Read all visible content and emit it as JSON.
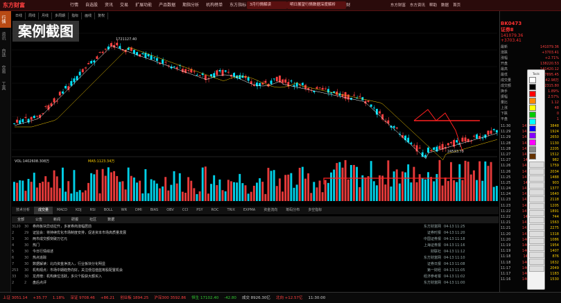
{
  "app": {
    "logo": "东方财富",
    "menu": [
      "行情",
      "自选股",
      "资讯",
      "交易",
      "扩展功能",
      "产品数据",
      "期指分析",
      "机构榜单",
      "东方指标",
      "全球焦点",
      "港美股",
      "期货",
      "外汇",
      "债券",
      "理财"
    ],
    "notices": [
      "3月行情解读",
      "明日展望行情数据深度解析"
    ],
    "right_menu": [
      "东方财富",
      "东方资讯",
      "帮助",
      "数据",
      "首页"
    ]
  },
  "overlay_title": "案例截图",
  "left_rail": [
    "行情",
    "资讯",
    "自选",
    "交易",
    "工具"
  ],
  "chart": {
    "tabs": [
      "日线",
      "周线",
      "月线",
      "多周期",
      "指标",
      "画线",
      "复权"
    ],
    "stock_title": "证券Ⅱ",
    "high_label": "1721127.40",
    "low_label": "24533.70",
    "volume_title": "VOL:1402608.308万",
    "volume_ma": "MA5:1123.34万",
    "colors": {
      "up": "#ff4040",
      "down": "#00e5ff",
      "ma5": "#ffffff",
      "ma10": "#ffd000",
      "ma20": "#ff00ff",
      "marker": "#ff2020"
    }
  },
  "bottom_tabs": [
    "技术分析",
    "成交量",
    "MACD",
    "KDJ",
    "RSI",
    "BOLL",
    "WR",
    "DMI",
    "BIAS",
    "OBV",
    "CCI",
    "PSY",
    "ROC",
    "TRIX",
    "EXPMA",
    "资金流向",
    "筹码分布",
    "多空指标"
  ],
  "news": {
    "head": [
      "全部",
      "公告",
      "新闻",
      "研报",
      "社区",
      "数据"
    ],
    "rows": [
      {
        "a": "3120",
        "b": "30",
        "text": "券商板块异动拉升，多家券商涨幅居前"
      },
      {
        "a": "2",
        "b": "29",
        "text": "证监会：将持续优化市场制度安排，促进资本市场高质量发展"
      },
      {
        "a": "3",
        "b": "30",
        "text": "两市成交额突破万亿元"
      },
      {
        "a": "4",
        "b": "30",
        "text": "热门"
      },
      {
        "a": "5",
        "b": "30",
        "text": "今日行情综述"
      },
      {
        "a": "6",
        "b": "30",
        "text": "热点追踪"
      },
      {
        "a": "7",
        "b": "30",
        "text": "数据解读：北向资金净流入，行业板块分化明显"
      },
      {
        "a": "253",
        "b": "30",
        "text": "机构观点：市场中期趋势向好，关注低估值蓝筹股配置机会"
      },
      {
        "a": "33",
        "b": "30",
        "text": "龙虎榜：机构席位活跃，多只个股获大额买入"
      },
      {
        "a": "2",
        "b": "2",
        "text": "盘后点评"
      }
    ],
    "right_rows": [
      {
        "src": "东方财富网",
        "t": "04-13 11:25"
      },
      {
        "src": "证券时报",
        "t": "04-13 11:20"
      },
      {
        "src": "中国证券报",
        "t": "04-13 11:18"
      },
      {
        "src": "上海证券报",
        "t": "04-13 11:16"
      },
      {
        "src": "财联社",
        "t": "04-13 11:12"
      },
      {
        "src": "东方财富网",
        "t": "04-13 11:10"
      },
      {
        "src": "证券日报",
        "t": "04-13 11:08"
      },
      {
        "src": "第一财经",
        "t": "04-13 11:05"
      },
      {
        "src": "经济参考报",
        "t": "04-13 11:02"
      },
      {
        "src": "东方财富网",
        "t": "04-13 11:00"
      }
    ]
  },
  "right_panel": {
    "code": "BK0473",
    "name": "证券Ⅱ",
    "price": "141079.36",
    "change": "+3703.41",
    "pct": "+2.71%",
    "quotes": [
      {
        "k": "最新",
        "v": "141079.36"
      },
      {
        "k": "涨跌",
        "v": "+3703.41"
      },
      {
        "k": "涨幅",
        "v": "+2.71%"
      },
      {
        "k": "开盘",
        "v": "138220.53"
      },
      {
        "k": "最高",
        "v": "141420.12"
      },
      {
        "k": "最低",
        "v": "137895.45"
      },
      {
        "k": "成交量",
        "v": "442.98万"
      },
      {
        "k": "成交额",
        "v": "72315.80"
      },
      {
        "k": "换手",
        "v": "1.89%"
      },
      {
        "k": "振幅",
        "v": "2.57%"
      },
      {
        "k": "量比",
        "v": "1.12"
      },
      {
        "k": "上涨",
        "v": "48"
      },
      {
        "k": "下跌",
        "v": "0"
      },
      {
        "k": "平盘",
        "v": "1"
      }
    ],
    "ticks": [
      {
        "tm": "11:30",
        "pr": "141079.3",
        "vl": "3848"
      },
      {
        "tm": "11:29",
        "pr": "141075.2",
        "vl": "1924"
      },
      {
        "tm": "11:29",
        "pr": "141070.8",
        "vl": "2650"
      },
      {
        "tm": "11:28",
        "pr": "141066.1",
        "vl": "1130"
      },
      {
        "tm": "11:28",
        "pr": "141061.7",
        "vl": "2205"
      },
      {
        "tm": "11:27",
        "pr": "141058.3",
        "vl": "1512"
      },
      {
        "tm": "11:27",
        "pr": "141052.0",
        "vl": "982"
      },
      {
        "tm": "11:26",
        "pr": "141048.6",
        "vl": "1759"
      },
      {
        "tm": "11:26",
        "pr": "141043.2",
        "vl": "2034"
      },
      {
        "tm": "11:25",
        "pr": "141040.9",
        "vl": "1488"
      },
      {
        "tm": "11:25",
        "pr": "141036.4",
        "vl": "903"
      },
      {
        "tm": "11:24",
        "pr": "141031.1",
        "vl": "1377"
      },
      {
        "tm": "11:24",
        "pr": "141028.5",
        "vl": "1640"
      },
      {
        "tm": "11:23",
        "pr": "141024.0",
        "vl": "2118"
      },
      {
        "tm": "11:23",
        "pr": "141019.6",
        "vl": "1205"
      },
      {
        "tm": "11:22",
        "pr": "141015.3",
        "vl": "1891"
      },
      {
        "tm": "11:22",
        "pr": "141011.8",
        "vl": "744"
      },
      {
        "tm": "11:21",
        "pr": "141008.2",
        "vl": "1563"
      },
      {
        "tm": "11:21",
        "pr": "141004.7",
        "vl": "2275"
      },
      {
        "tm": "11:20",
        "pr": "141000.1",
        "vl": "1318"
      },
      {
        "tm": "11:20",
        "pr": "140996.5",
        "vl": "1086"
      },
      {
        "tm": "11:19",
        "pr": "140992.0",
        "vl": "1954"
      },
      {
        "tm": "11:19",
        "pr": "140988.4",
        "vl": "1407"
      },
      {
        "tm": "11:18",
        "pr": "140984.9",
        "vl": "876"
      },
      {
        "tm": "11:18",
        "pr": "140980.3",
        "vl": "1632"
      },
      {
        "tm": "11:17",
        "pr": "140976.7",
        "vl": "2049"
      },
      {
        "tm": "11:17",
        "pr": "140972.1",
        "vl": "1183"
      },
      {
        "tm": "11:16",
        "pr": "140968.5",
        "vl": "1530"
      }
    ]
  },
  "palette": {
    "title": "Tools",
    "swatches": [
      "#ffffff",
      "#000000",
      "#ff0000",
      "#ff8800",
      "#ffff00",
      "#00cc00",
      "#00ffff",
      "#0000ff",
      "#8800ff",
      "#ff00ff",
      "#888888",
      "#663300"
    ]
  },
  "status": [
    {
      "t": "上证 3051.14",
      "c": "up"
    },
    {
      "t": "+35.77",
      "c": "up"
    },
    {
      "t": "1.18%",
      "c": "up"
    },
    {
      "t": "深证 9708.46",
      "c": "up"
    },
    {
      "t": "+86.21",
      "c": "up"
    },
    {
      "t": "创业板 1894.25",
      "c": "up"
    },
    {
      "t": "沪深300 3592.86",
      "c": "up"
    },
    {
      "t": "恒生 17102.40",
      "c": "dn"
    },
    {
      "t": "-42.80",
      "c": "dn"
    },
    {
      "t": "成交 8926.30亿",
      "c": "neu"
    },
    {
      "t": "北向 +12.57亿",
      "c": "up"
    },
    {
      "t": "11:30:00",
      "c": "neu"
    }
  ]
}
